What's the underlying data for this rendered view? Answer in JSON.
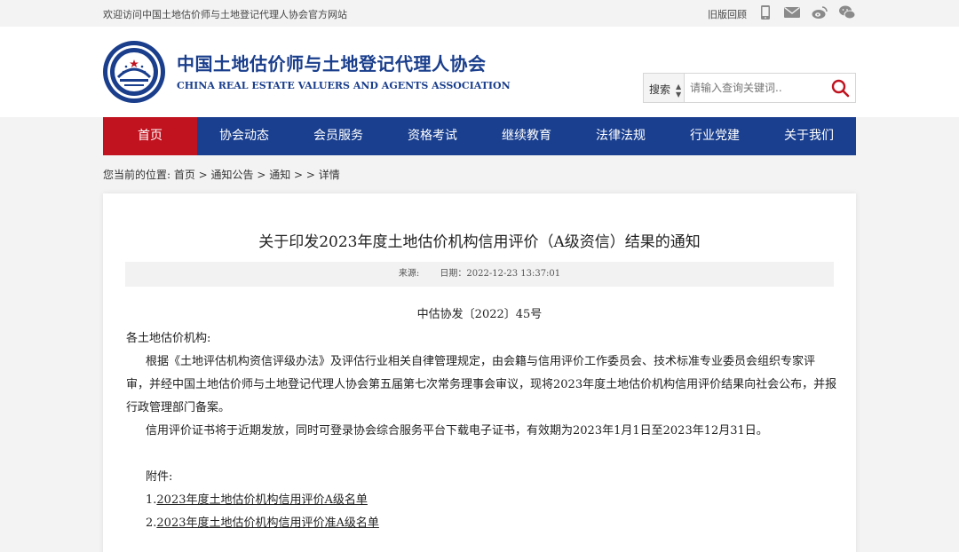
{
  "topbar": {
    "welcome": "欢迎访问中国土地估价师与土地登记代理人协会官方网站",
    "old_version": "旧版回顾",
    "icons": [
      "mobile-icon",
      "mail-icon",
      "weibo-icon",
      "wechat-icon"
    ]
  },
  "header": {
    "title_cn": "中国土地估价师与土地登记代理人协会",
    "title_en": "CHINA REAL ESTATE VALUERS AND AGENTS ASSOCIATION"
  },
  "search": {
    "select_label": "搜索",
    "placeholder": "请输入查询关键词.."
  },
  "nav": {
    "items": [
      "首页",
      "协会动态",
      "会员服务",
      "资格考试",
      "继续教育",
      "法律法规",
      "行业党建",
      "关于我们"
    ],
    "active_index": 0
  },
  "breadcrumb": "您当前的位置: 首页 > 通知公告 > 通知 > > 详情",
  "article": {
    "title": "关于印发2023年度土地估价机构信用评价（A级资信）结果的通知",
    "source": "来源:",
    "date": "日期：2022-12-23 13:37:01",
    "doc_no": "中估协发〔2022〕45号",
    "salutation": "各土地估价机构:",
    "para1_line1": "根据《土地评估机构资信评级办法》及评估行业相关自律管理规定，由会籍与信用评价工作委员会、技术标准专业委员会组织专家评",
    "para1_line2": "审，并经中国土地估价师与土地登记代理人协会第五届第七次常务理事会审议，现将2023年度土地估价机构信用评价结果向社会公布，并报",
    "para1_line3": "行政管理部门备案。",
    "para2": "信用评价证书将于近期发放，同时可登录协会综合服务平台下载电子证书，有效期为2023年1月1日至2023年12月31日。",
    "attachments_label": "附件:",
    "attachments": [
      {
        "prefix": "1.",
        "text": "2023年度土地估价机构信用评价A级名单"
      },
      {
        "prefix": "2.",
        "text": "2023年度土地估价机构信用评价准A级名单"
      }
    ]
  },
  "colors": {
    "nav_bg": "#1a3f8f",
    "nav_active": "#c0131f",
    "brand_blue": "#1a3e8c",
    "search_red": "#c0131f"
  }
}
